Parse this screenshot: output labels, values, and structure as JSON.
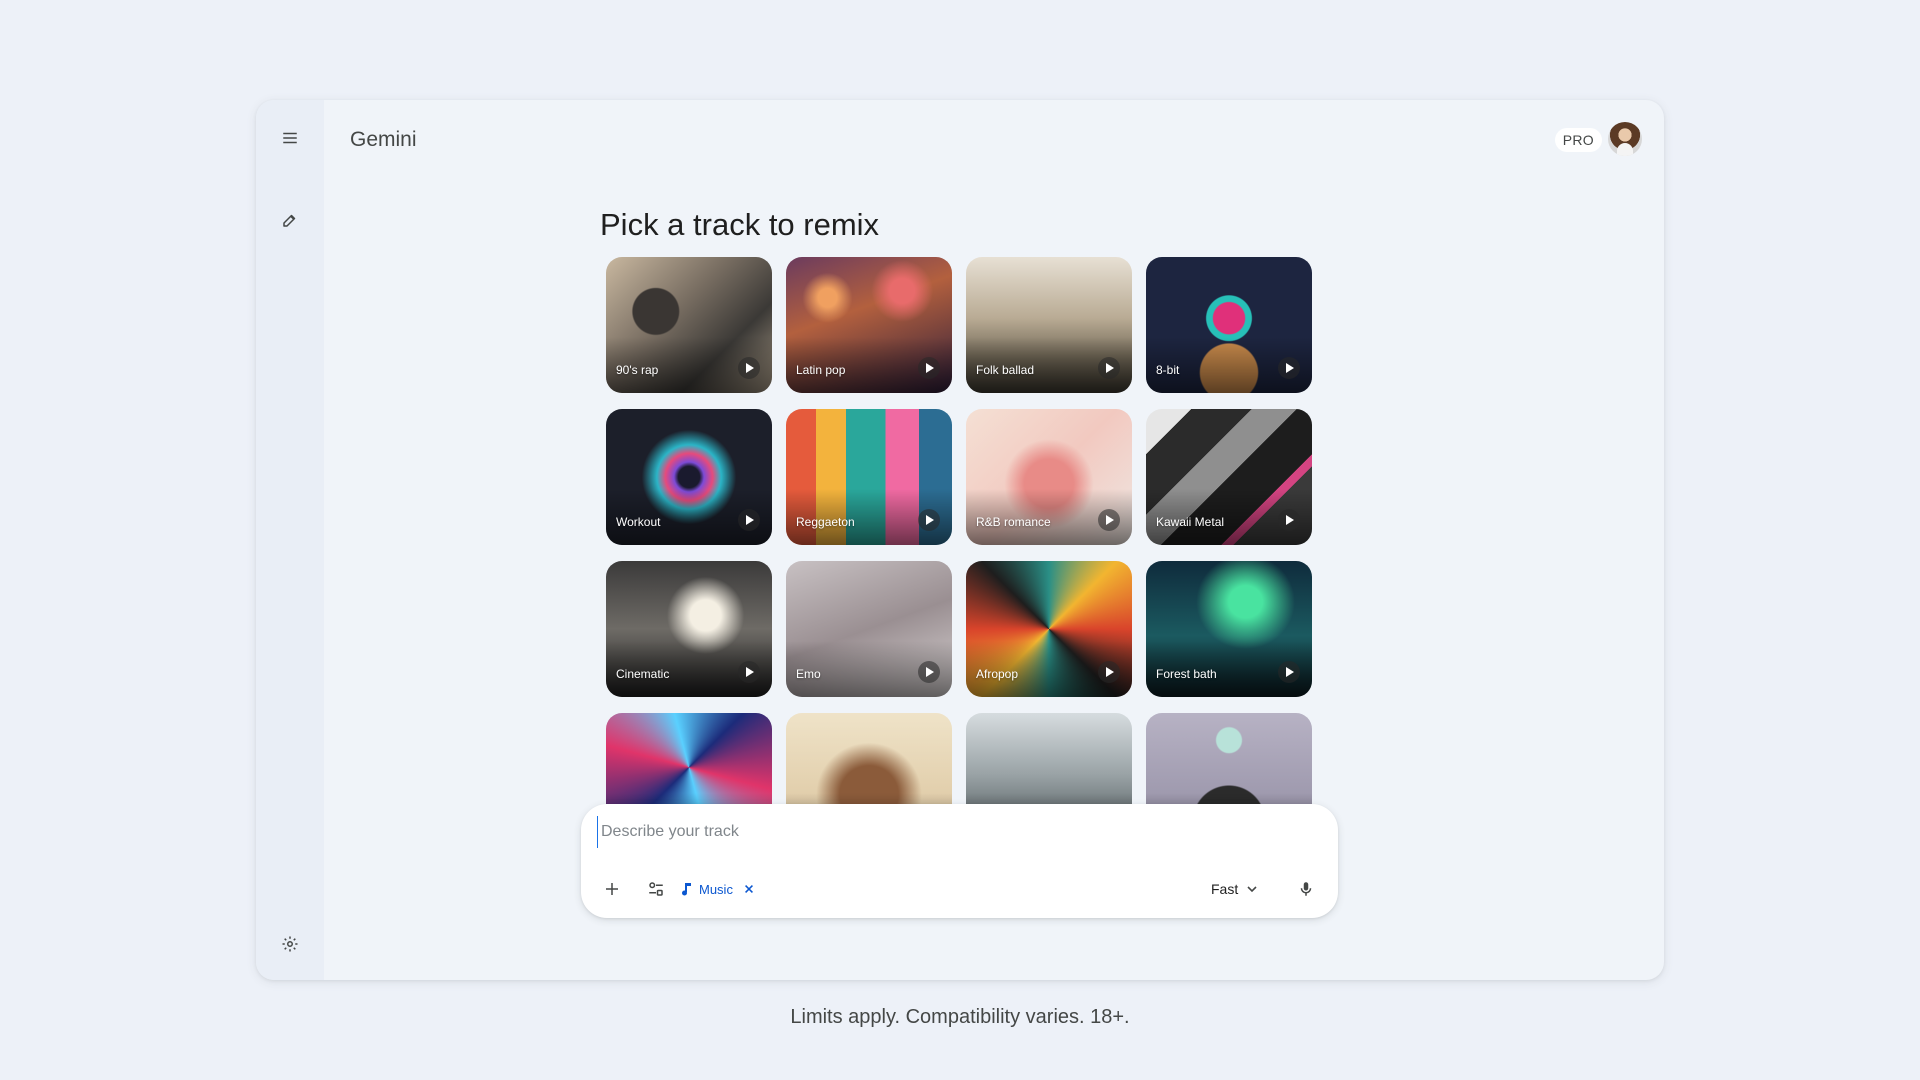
{
  "app": {
    "title": "Gemini",
    "plan_badge": "PRO"
  },
  "main": {
    "heading": "Pick a track to remix"
  },
  "tracks": [
    {
      "label": "90's rap"
    },
    {
      "label": "Latin pop"
    },
    {
      "label": "Folk ballad"
    },
    {
      "label": "8-bit"
    },
    {
      "label": "Workout"
    },
    {
      "label": "Reggaeton"
    },
    {
      "label": "R&B romance"
    },
    {
      "label": "Kawaii Metal"
    },
    {
      "label": "Cinematic"
    },
    {
      "label": "Emo"
    },
    {
      "label": "Afropop"
    },
    {
      "label": "Forest bath"
    },
    {
      "label": ""
    },
    {
      "label": ""
    },
    {
      "label": ""
    },
    {
      "label": ""
    }
  ],
  "composer": {
    "placeholder": "Describe your track",
    "value": "",
    "chip_label": "Music",
    "model_label": "Fast"
  },
  "footer": {
    "note": "Limits apply. Compatibility varies. 18+."
  },
  "icons": {
    "menu": "menu-icon",
    "new_chat": "edit-icon",
    "settings": "gear-icon",
    "add": "plus-icon",
    "tools": "tune-icon",
    "music": "music-note-icon",
    "close": "close-icon",
    "dropdown": "chevron-down-icon",
    "mic": "microphone-icon"
  },
  "colors": {
    "background": "#edf1f8",
    "window": "#f0f4f9",
    "rail": "#e9eef6",
    "accent": "#0b57d0"
  }
}
